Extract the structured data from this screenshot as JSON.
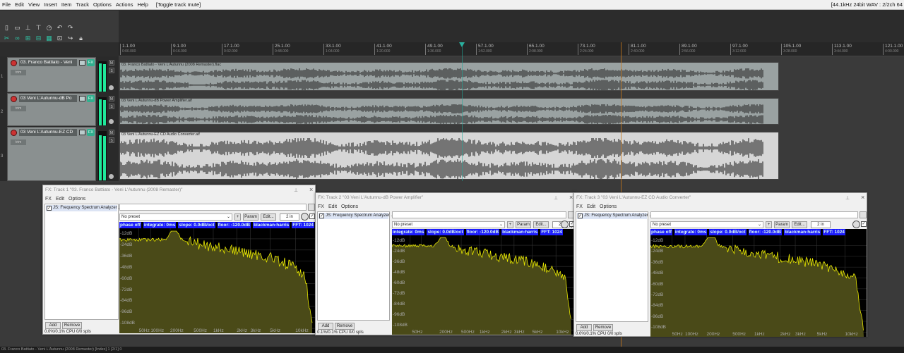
{
  "menubar": {
    "items": [
      "File",
      "Edit",
      "View",
      "Insert",
      "Item",
      "Track",
      "Options",
      "Actions",
      "Help"
    ],
    "status": "[Toggle track mute]",
    "right": "[44.1kHz 24bit WAV : 2/2ch 64"
  },
  "ruler": {
    "ticks": [
      {
        "bar": "1.1.00",
        "time": "0:00.000"
      },
      {
        "bar": "9.1.00",
        "time": "0:16.000"
      },
      {
        "bar": "17.1.00",
        "time": "0:32.000"
      },
      {
        "bar": "25.1.00",
        "time": "0:48.000"
      },
      {
        "bar": "33.1.00",
        "time": "1:04.000"
      },
      {
        "bar": "41.1.00",
        "time": "1:20.000"
      },
      {
        "bar": "49.1.00",
        "time": "1:36.000"
      },
      {
        "bar": "57.1.00",
        "time": "1:52.000"
      },
      {
        "bar": "65.1.00",
        "time": "2:08.000"
      },
      {
        "bar": "73.1.00",
        "time": "2:24.000"
      },
      {
        "bar": "81.1.00",
        "time": "2:40.000"
      },
      {
        "bar": "89.1.00",
        "time": "2:56.000"
      },
      {
        "bar": "97.1.00",
        "time": "3:12.000"
      },
      {
        "bar": "105.1.00",
        "time": "3:28.000"
      },
      {
        "bar": "113.1.00",
        "time": "3:44.000"
      },
      {
        "bar": "121.1.00",
        "time": "4:00.000"
      }
    ]
  },
  "tracks": [
    {
      "num": "1",
      "name": "03. Franco Battiato - Veni",
      "fx": "FX",
      "trim": "trim",
      "item": "03. Franco Battiato - Veni L'Autunnu (2008 Remaster).flac"
    },
    {
      "num": "2",
      "name": "03 Veni L'Autunnu-dB Po",
      "fx": "FX",
      "trim": "trim",
      "item": "03 Veni L'Autunnu-dB Power Amplifier.aif"
    },
    {
      "num": "3",
      "name": "03 Veni L'Autunnu-EZ CD",
      "fx": "FX",
      "trim": "trim",
      "item": "03 Veni L'Autunnu-EZ CD Audio Converter.aif"
    }
  ],
  "fx_windows": [
    {
      "title": "FX: Track 1 \"03. Franco Battiato - Veni L'Autunnu (2008 Remaster)\"",
      "menu": [
        "FX",
        "Edit",
        "Options"
      ],
      "plugin": "JS: Frequency Spectrum Analyzer ...",
      "preset": "No preset",
      "param": "Param",
      "edit": "Edit...",
      "io": "2 in",
      "add": "Add",
      "remove": "Remove",
      "cpu": "0.0%/0.1% CPU 0/0 spls",
      "header": [
        "phase off",
        "integrate: 0ms",
        "slope: 0.0dB/oct",
        "floor: -120.0dB",
        "blackman-harris",
        "FFT: 1024"
      ],
      "db_labels": [
        "-12dB",
        "-24dB",
        "-36dB",
        "-48dB",
        "-60dB",
        "-72dB",
        "-84dB",
        "-96dB",
        "-108dB"
      ],
      "freq_labels": [
        "50Hz",
        "100Hz",
        "200Hz",
        "500Hz",
        "1kHz",
        "2kHz",
        "3kHz",
        "5kHz",
        "10kHz"
      ]
    },
    {
      "title": "FX: Track 2 \"03 Veni L'Autunnu-dB Power Amplifier\"",
      "menu": [
        "FX",
        "Edit",
        "Options"
      ],
      "plugin": "JS: Frequency Spectrum Analyzer ...",
      "preset": "No preset",
      "param": "Param",
      "edit": "Edit...",
      "io": "2 in",
      "add": "Add",
      "remove": "Remove",
      "cpu": "0.1%/0.1% CPU 0/0 spls",
      "header": [
        "integrate: 0ms",
        "slope: 0.0dB/oct",
        "floor: -120.0dB",
        "blackman-harris",
        "FFT: 1024"
      ],
      "db_labels": [
        "-12dB",
        "-24dB",
        "-36dB",
        "-48dB",
        "-60dB",
        "-72dB",
        "-84dB",
        "-96dB",
        "-108dB"
      ],
      "freq_labels": [
        "50Hz",
        "200Hz",
        "500Hz",
        "1kHz",
        "2kHz",
        "3kHz",
        "5kHz",
        "10kHz"
      ]
    },
    {
      "title": "FX: Track 3 \"03 Veni L'Autunnu-EZ CD Audio Converter\"",
      "menu": [
        "FX",
        "Edit",
        "Options"
      ],
      "plugin": "JS: Frequency Spectrum Analyzer ...",
      "preset": "No preset",
      "param": "Param",
      "edit": "Edit...",
      "io": "2 in",
      "add": "Add",
      "remove": "Remove",
      "cpu": "0.0%/0.1% CPU 0/0 spls",
      "header": [
        "phase off",
        "integrate: 0ms",
        "slope: 0.0dB/oct",
        "floor: -120.0dB",
        "blackman-harris",
        "FFT: 1024"
      ],
      "db_labels": [
        "-12dB",
        "-24dB",
        "-36dB",
        "-48dB",
        "-60dB",
        "-72dB",
        "-84dB",
        "-96dB",
        "-108dB"
      ],
      "freq_labels": [
        "50Hz",
        "100Hz",
        "200Hz",
        "500Hz",
        "1kHz",
        "2kHz",
        "3kHz",
        "5kHz",
        "10kHz"
      ]
    }
  ],
  "bottom": "03. Franco Battiato - Veni L'Autunnu (2008 Remaster) [Index] 1 [2/1] 0",
  "colors": {
    "accent": "#2fc4a6",
    "meter": "#1fe89a",
    "spectrum_line": "#e8e800",
    "spectrum_fill": "#4a4a18",
    "fft_header": "#1d1dff"
  }
}
